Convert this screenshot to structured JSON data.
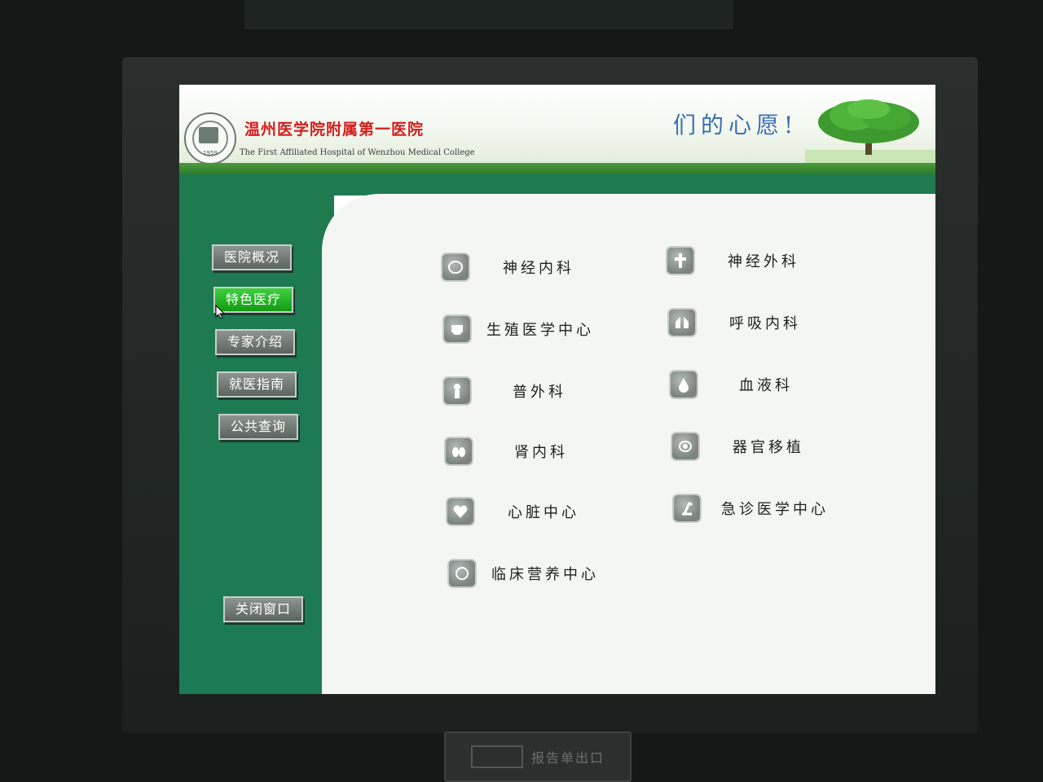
{
  "header": {
    "hospital_name": "温州医学院附属第一医院",
    "hospital_name_en": "The First Affiliated Hospital of Wenzhou Medical College",
    "logo_year": "1959",
    "slogan": "们的心愿!"
  },
  "nav": [
    {
      "label": "医院概况",
      "active": false
    },
    {
      "label": "特色医疗",
      "active": true
    },
    {
      "label": "专家介绍",
      "active": false
    },
    {
      "label": "就医指南",
      "active": false
    },
    {
      "label": "公共查询",
      "active": false
    }
  ],
  "close_button": "关闭窗口",
  "departments": [
    {
      "label": "神经内科",
      "icon": "brain-icon"
    },
    {
      "label": "神经外科",
      "icon": "spine-icon"
    },
    {
      "label": "生殖医学中心",
      "icon": "pelvis-icon"
    },
    {
      "label": "呼吸内科",
      "icon": "lungs-icon"
    },
    {
      "label": "普外科",
      "icon": "torso-icon"
    },
    {
      "label": "血液科",
      "icon": "blood-drop-icon"
    },
    {
      "label": "肾内科",
      "icon": "kidney-icon"
    },
    {
      "label": "器官移植",
      "icon": "organ-icon"
    },
    {
      "label": "心脏中心",
      "icon": "heart-icon"
    },
    {
      "label": "急诊医学中心",
      "icon": "emergency-icon"
    },
    {
      "label": "临床营养中心",
      "icon": "nutrition-icon"
    }
  ],
  "kiosk_slot_label": "报告单出口",
  "colors": {
    "header_red": "#d21e1e",
    "slogan_blue": "#3a6fb4",
    "panel_green": "#1f7a4f",
    "active_button_green": "#1bb01b"
  }
}
